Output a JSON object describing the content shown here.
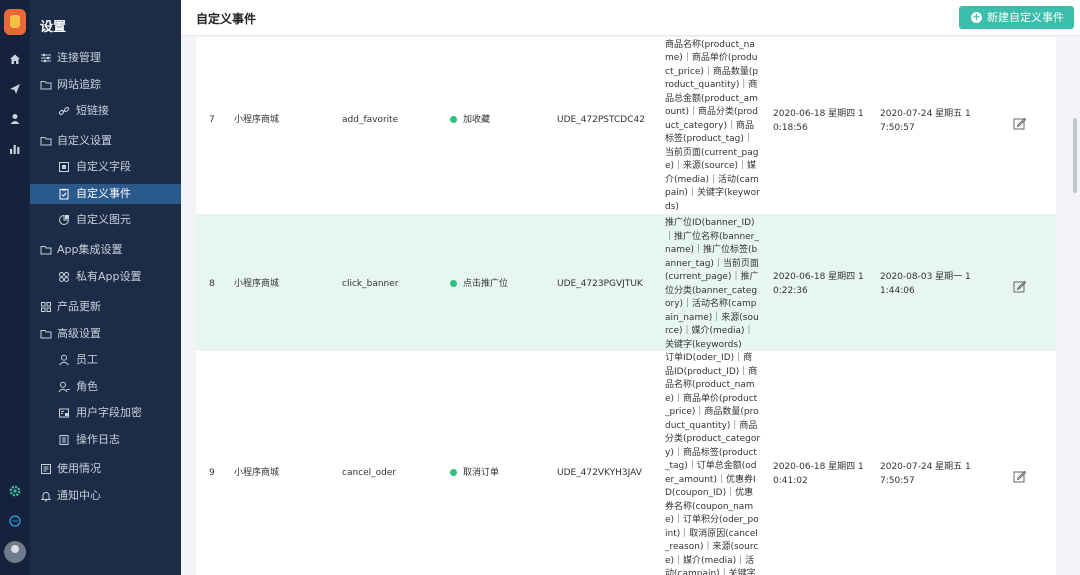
{
  "sidebar": {
    "title": "设置",
    "items": [
      {
        "label": "连接管理",
        "icon": "link-settings-icon"
      },
      {
        "label": "网站追踪",
        "icon": "folder-icon"
      },
      {
        "label": "短链接",
        "icon": "chain-icon"
      },
      {
        "label": "自定义设置",
        "icon": "folder-icon"
      },
      {
        "label": "自定义字段",
        "icon": "field-icon"
      },
      {
        "label": "自定义事件",
        "icon": "event-icon",
        "active": true
      },
      {
        "label": "自定义图元",
        "icon": "shape-icon"
      },
      {
        "label": "App集成设置",
        "icon": "folder-icon"
      },
      {
        "label": "私有App设置",
        "icon": "app-grid-icon"
      },
      {
        "label": "产品更新",
        "icon": "grid-icon"
      },
      {
        "label": "高级设置",
        "icon": "folder-icon"
      },
      {
        "label": "员工",
        "icon": "user-icon"
      },
      {
        "label": "角色",
        "icon": "role-icon"
      },
      {
        "label": "用户字段加密",
        "icon": "encrypt-icon"
      },
      {
        "label": "操作日志",
        "icon": "log-icon"
      },
      {
        "label": "使用情况",
        "icon": "usage-icon"
      },
      {
        "label": "通知中心",
        "icon": "bell-icon"
      }
    ]
  },
  "header": {
    "title": "自定义事件",
    "new_button": "新建自定义事件"
  },
  "table": {
    "rows": [
      {
        "index": "7",
        "app": "小程序商城",
        "event_key": "add_favorite",
        "name": "加收藏",
        "event_id": "UDE_472PSTCDC42",
        "attributes": "商品ID(product_ID)｜商品名称(product_name)｜商品单价(product_price)｜商品数量(product_quantity)｜商品总金额(product_amount)｜商品分类(product_category)｜商品标签(product_tag)｜当前页面(current_page)｜来源(source)｜媒介(media)｜活动(campain)｜关键字(keywords)",
        "created": "2020-06-18 星期四 10:18:56",
        "updated": "2020-07-24 星期五 17:50:57"
      },
      {
        "index": "8",
        "app": "小程序商城",
        "event_key": "click_banner",
        "name": "点击推广位",
        "event_id": "UDE_4723PGVJTUK",
        "attributes": "推广位ID(banner_ID)｜推广位名称(banner_name)｜推广位标签(banner_tag)｜当前页面(current_page)｜推广位分类(banner_category)｜活动名称(campain_name)｜来源(source)｜媒介(media)｜关键字(keywords)",
        "created": "2020-06-18 星期四 10:22:36",
        "updated": "2020-08-03 星期一 11:44:06"
      },
      {
        "index": "9",
        "app": "小程序商城",
        "event_key": "cancel_oder",
        "name": "取消订单",
        "event_id": "UDE_472VKYH3JAV",
        "attributes": "订单ID(oder_ID)｜商品ID(product_ID)｜商品名称(product_name)｜商品单价(product_price)｜商品数量(product_quantity)｜商品分类(product_category)｜商品标签(product_tag)｜订单总金额(oder_amount)｜优惠券ID(coupon_ID)｜优惠券名称(coupon_name)｜订单积分(oder_point)｜取消原因(cancel_reason)｜来源(source)｜媒介(media)｜活动(campain)｜关键字(keywords)",
        "created": "2020-06-18 星期四 10:41:02",
        "updated": "2020-07-24 星期五 17:50:57"
      }
    ]
  }
}
